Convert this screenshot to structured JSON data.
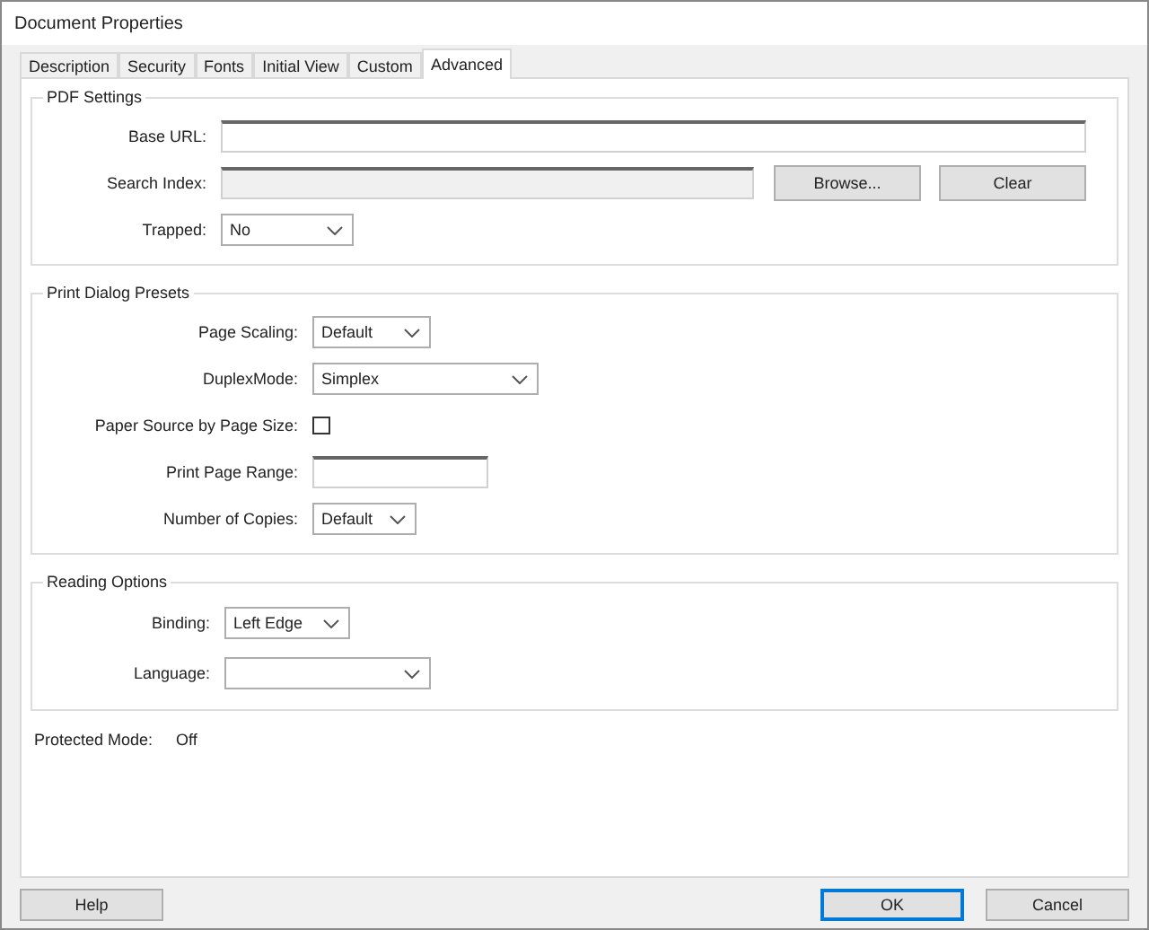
{
  "window": {
    "title": "Document Properties"
  },
  "tabs": [
    {
      "label": "Description",
      "selected": false
    },
    {
      "label": "Security",
      "selected": false
    },
    {
      "label": "Fonts",
      "selected": false
    },
    {
      "label": "Initial View",
      "selected": false
    },
    {
      "label": "Custom",
      "selected": false
    },
    {
      "label": "Advanced",
      "selected": true
    }
  ],
  "sections": [
    {
      "title": "PDF Settings",
      "fields": [
        {
          "kind": "text",
          "label": "Base URL:",
          "disabled": false
        },
        {
          "kind": "text",
          "label": "Search Index:",
          "disabled": true,
          "buttons": [
            "Browse...",
            "Clear"
          ]
        },
        {
          "kind": "dropdown",
          "label": "Trapped:",
          "value": "No"
        }
      ]
    },
    {
      "title": "Print Dialog Presets",
      "fields": [
        {
          "kind": "dropdown",
          "label": "Page Scaling:",
          "value": "Default"
        },
        {
          "kind": "dropdown",
          "label": "DuplexMode:",
          "value": "Simplex"
        },
        {
          "kind": "checkbox",
          "label": "Paper Source by Page Size:",
          "checked": false
        },
        {
          "kind": "text",
          "label": "Print Page Range:",
          "disabled": false
        },
        {
          "kind": "dropdown",
          "label": "Number of Copies:",
          "value": "Default"
        }
      ]
    },
    {
      "title": "Reading Options",
      "fields": [
        {
          "kind": "dropdown",
          "label": "Binding:",
          "value": "Left Edge"
        },
        {
          "kind": "dropdown",
          "label": "Language:"
        }
      ]
    }
  ],
  "protected_mode": {
    "label": "Protected Mode:",
    "value": "Off"
  },
  "footer_buttons": [
    {
      "label": "Help",
      "default": false
    },
    {
      "label": "OK",
      "default": true
    },
    {
      "label": "Cancel",
      "default": false
    }
  ]
}
